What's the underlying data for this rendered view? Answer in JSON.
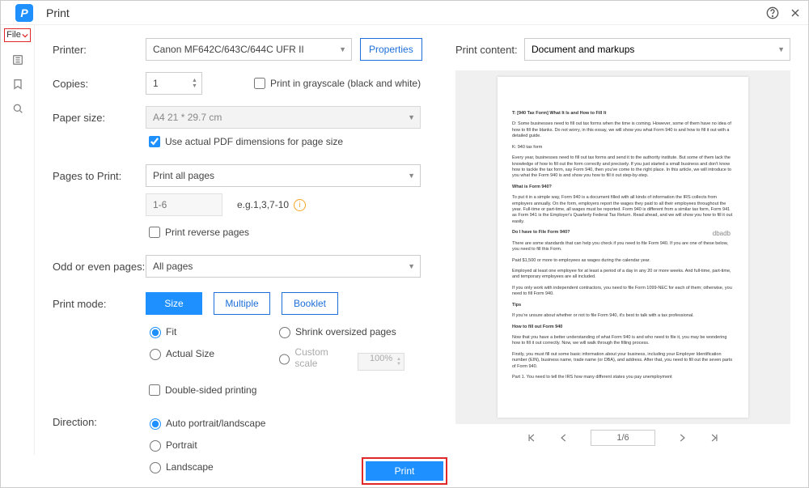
{
  "window": {
    "title": "Print"
  },
  "toolbar": {
    "file_label": "File"
  },
  "form": {
    "printer_label": "Printer:",
    "printer_value": "Canon MF642C/643C/644C UFR II",
    "properties_btn": "Properties",
    "copies_label": "Copies:",
    "copies_value": "1",
    "grayscale_label": "Print in grayscale (black and white)",
    "paper_label": "Paper size:",
    "paper_value": "A4 21 * 29.7 cm",
    "actual_dim_label": "Use actual PDF dimensions for page size",
    "pages_label": "Pages to Print:",
    "pages_value": "Print all pages",
    "range_placeholder": "1-6",
    "range_eg": "e.g.1,3,7-10",
    "reverse_label": "Print reverse pages",
    "oddeven_label": "Odd or even pages:",
    "oddeven_value": "All pages",
    "mode_label": "Print mode:",
    "seg_size": "Size",
    "seg_multiple": "Multiple",
    "seg_booklet": "Booklet",
    "r_fit": "Fit",
    "r_shrink": "Shrink oversized pages",
    "r_actual": "Actual Size",
    "r_custom": "Custom scale",
    "custom_val": "100%",
    "double_label": "Double-sided printing",
    "direction_label": "Direction:",
    "dir_auto": "Auto portrait/landscape",
    "dir_portrait": "Portrait",
    "dir_landscape": "Landscape"
  },
  "preview": {
    "label": "Print content:",
    "value": "Document and markups",
    "page_indicator": "1/6",
    "watermark": "dbadb"
  },
  "doc": {
    "p1": "T: [940 Tax Form] What It Is and How to Fill It",
    "p2": "D: Some businesses need to fill out tax forms when the time is coming. However, some of them have no idea of how to fill the blanks. Do not worry, in this essay, we will show you what Form 940 is and how to fill it out with a detailed guide.",
    "p3": "K: 940 tax form",
    "p4": "Every year, businesses need to fill out tax forms and send it to the authority institute. But some of them lack the knowledge of how to fill out the form correctly and precisely. If you just started a small business and don't know how to tackle the tax form, say Form 940, then you've come to the right place. In this article, we will introduce to you what the Form 940 is and show you how to fill it out step-by-step.",
    "h1": "What is Form 940?",
    "p5": "To put it in a simple way, Form 940 is a document filled with all kinds of information the IRS collects from employers annually. On the form, employers report the wages they paid to all their employees throughout the year. Full-time or part-time, all wages must be reported. Form 940 is different from a similar tax form, Form 941 as Form 941 is the Employer's Quarterly Federal Tax Return. Read ahead, and we will show you how to fill it out easily.",
    "h2": "Do I have to File Form 940?",
    "p6": "There are some standards that can help you check if you need to file Form 940. If you are one of these below, you need to fill this Form.",
    "p7": "Paid $1,500 or more to employees as wages during the calendar year.",
    "p8": "Employed at least one employee for at least a period of a day in any 20 or more weeks. And full-time, part-time, and temporary employees are all included.",
    "p9": "If you only work with independent contractors, you need to file Form 1099-NEC for each of them; otherwise, you need to fill Form 940.",
    "h3": "Tips",
    "p10": "If you're unsure about whether or not to file Form 940, it's best to talk with a tax professional.",
    "h4": "How to fill out Form 940",
    "p11": "Now that you have a better understanding of what Form 940 is and who need to file it, you may be wondering how to fill it out correctly. Now, we will walk through the filling process.",
    "p12": "Firstly, you must fill out some basic information about your business, including your Employer Identification number (EIN), business name, trade name (or DBA), and address. After that, you need to fill out the seven parts of Form 940.",
    "p13": "Part 1. You need to tell the IRS how many different states you pay unemployment"
  },
  "footer": {
    "print_btn": "Print"
  }
}
